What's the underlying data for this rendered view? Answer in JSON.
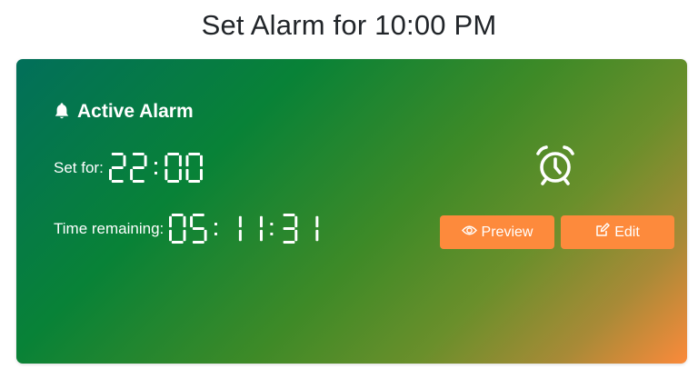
{
  "page": {
    "title": "Set Alarm for 10:00 PM"
  },
  "card": {
    "header": "Active Alarm",
    "header_icon": "bell-icon",
    "set_for_label": "Set for:",
    "set_for_value": "22:00",
    "remaining_label": "Time remaining:",
    "remaining_value": "05:11:31",
    "status_icon": "alarm-clock-icon"
  },
  "actions": {
    "preview_label": "Preview",
    "preview_icon": "eye-icon",
    "edit_label": "Edit",
    "edit_icon": "edit-icon"
  },
  "colors": {
    "gradient_start": "#026f5a",
    "gradient_mid": "#3e8a27",
    "gradient_end": "#fb8a3b",
    "button": "#fd8a3c",
    "title_text": "#212529"
  }
}
